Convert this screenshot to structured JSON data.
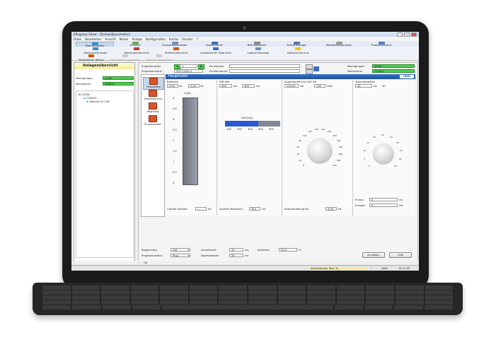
{
  "window": {
    "title": "EPegasus Silver - [Schweißparameter]"
  },
  "menu": [
    "Datei",
    "Bearbeiten",
    "Ansicht",
    "Modul",
    "Anlage",
    "Konfiguration",
    "Extras",
    "Fenster",
    "?"
  ],
  "tabs": [
    {
      "label": "Modulauswahl",
      "color": "#2d8fd6",
      "active": true
    },
    {
      "label": "Analyse",
      "color": "#6aa84f"
    },
    {
      "label": "Schweißparameter",
      "color": "#6b8fc6"
    },
    {
      "label": "Inspektionen",
      "color": "#3a6cc0"
    },
    {
      "label": "Betriebsdaten",
      "color": "#888"
    },
    {
      "label": "Schweißzange",
      "color": "#5577aa"
    },
    {
      "label": "Modulkonfiguration",
      "color": "#999"
    },
    {
      "label": "Prozessansicht",
      "color": "#4f7fbf"
    }
  ],
  "toolbar2": [
    {
      "label": "Modulmeldungen",
      "color": "#2d8fd6"
    },
    {
      "label": "Wartungsübersicht",
      "color": "#c0392b"
    },
    {
      "label": "Sprikenübersicht",
      "color": "#d35400"
    },
    {
      "label": "Inspektionen Übersicht",
      "color": "#3a6cc0"
    },
    {
      "label": "Logbuchanzeige",
      "color": "#6b8fc6"
    },
    {
      "label": "Datensicherung",
      "color": "#f1c40f"
    }
  ],
  "toolbar3": [
    {
      "label": "Moduldaten öffnen"
    },
    {
      "label": "Moduldaten speichern"
    },
    {
      "label": "Module vergleichen"
    }
  ],
  "sidebar": {
    "header": "Anlagenübersicht",
    "modulgruppe_label": "Modulgruppe",
    "modulgruppe_value": "1200L",
    "modulname_label": "Modulname",
    "modulname_value": "1200H1",
    "tree": [
      "1200L",
      "1200H1",
      "Detrust SV 236"
    ]
  },
  "program": {
    "programmwahl_label": "Programmwahl",
    "programmwahl_value": "1",
    "programmname_label": "Programmname",
    "programmname_value": "3227-X/3U-2",
    "punktname_label": "Punktname",
    "punktnummer_label": "Punktnummer",
    "modulgruppe_label": "Modulgruppe",
    "modulgruppe_value": "1200L",
    "modulname_label": "Modulname",
    "modulname_value": "1200H1"
  },
  "nav": [
    {
      "label": "Hauptseite",
      "active": true
    },
    {
      "label": "Zeitsteuerung"
    },
    {
      "label": "Regelung"
    },
    {
      "label": "Grundeinstell."
    }
  ],
  "page": {
    "title": "Hauptseite",
    "logo": "HWH",
    "basiszeit_label": "Basiszeit",
    "basiszeit_value": "5.00",
    "basiszeit_unit1": "kA",
    "basiszeit_value2": "5.00",
    "basiszeit_unit2": "kA",
    "iqr_label": "IQR Zeit",
    "iqr_value": "300",
    "iqr_unit1": "ms",
    "iqr_value2": "300",
    "iqr_unit2": "ms",
    "anpress_label": "Anpresskraft (ms 100 ms",
    "anpress_value": "130.00",
    "anpress_unit": "kN",
    "anpress_value2": "130",
    "anpress_unit2": "kN/s",
    "strom_label": "Stromreduktion",
    "strom_value": "30",
    "strom_unit": "kA",
    "strom_value2": "30",
    "bar_title": "I [kA]",
    "zeit_title": "Zeit [ms]",
    "letzter_label": "I letzter Spritzer",
    "letzter_value": "---",
    "letzter_unit": "kA",
    "spritzer_label": "Spritzer Maximum",
    "spritzer_value": "310",
    "spritzer_unit": "ms",
    "stromerh_label": "Stromerhöhung bis",
    "stromerh_value": "0.00",
    "stromerh_unit": "kA",
    "rmax_label": "R max.",
    "rmax_value": "0",
    "rmax_unit": "ms",
    "energie_label": "Energie",
    "energie_value": "0",
    "energie_unit": "ms",
    "regelmodus_label": "Regelmodus",
    "regelmodus_value": "IQR",
    "programmstatus_label": "Programmstatus",
    "programmstatus_value": "Prog.",
    "vorhaltezeit_label": "Vorhaltezeit",
    "vorhaltezeit_value": "50",
    "vorhaltezeit_unit": "ms",
    "nachhaltezeit_label": "Nachhaltezeit",
    "nachhaltezeit_value": "50",
    "nachhaltezeit_unit": "ms",
    "sollstrom_label": "Sollstrom",
    "sollstrom_value": "20.0",
    "sollstrom_unit": "%",
    "schliessen_label": "Schließen",
    "hilfe_label": "Hilfe"
  },
  "bar_ticks": [
    "4",
    "3,5",
    "3",
    "2,5",
    "2",
    "1,5",
    "1",
    "0,5",
    "0"
  ],
  "zeit_ticks": [
    "100",
    "200",
    "300",
    "400",
    "500"
  ],
  "dial1_ticks": [
    "0",
    "20",
    "40",
    "60",
    "80",
    "100",
    "120",
    "140",
    "160",
    "180",
    "200",
    "220",
    "240",
    "260",
    "280",
    "300"
  ],
  "dial2_ticks": [
    "0",
    "5",
    "10",
    "15",
    "20",
    "25",
    "30",
    "35",
    "40",
    "45",
    "50"
  ],
  "ok_label": "OK",
  "status": {
    "user": "Administrator (Pos. 3)",
    "num": "NUM",
    "time": "12:11:33"
  }
}
